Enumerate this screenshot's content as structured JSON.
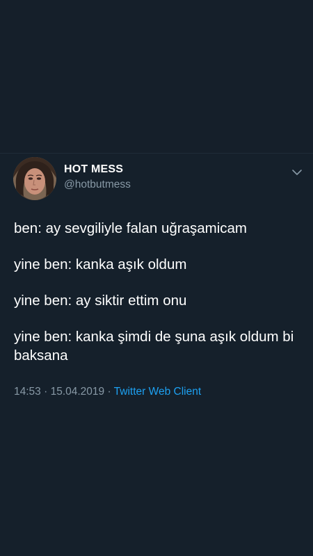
{
  "tweet": {
    "display_name": "HOT MESS",
    "handle": "@hotbutmess",
    "lines": [
      "ben: ay sevgiliyle falan uğraşamicam",
      "yine ben: kanka aşık oldum",
      "yine ben: ay siktir ettim onu",
      "yine ben: kanka şimdi de şuna aşık oldum bi baksana"
    ],
    "time": "14:53",
    "separator": " · ",
    "date": "15.04.2019",
    "client": "Twitter Web Client"
  },
  "icons": {
    "avatar": "profile-photo",
    "menu": "chevron-down-icon"
  },
  "colors": {
    "background": "#15202b",
    "text": "#ffffff",
    "secondary": "#8899a6",
    "link": "#1da1f2"
  }
}
